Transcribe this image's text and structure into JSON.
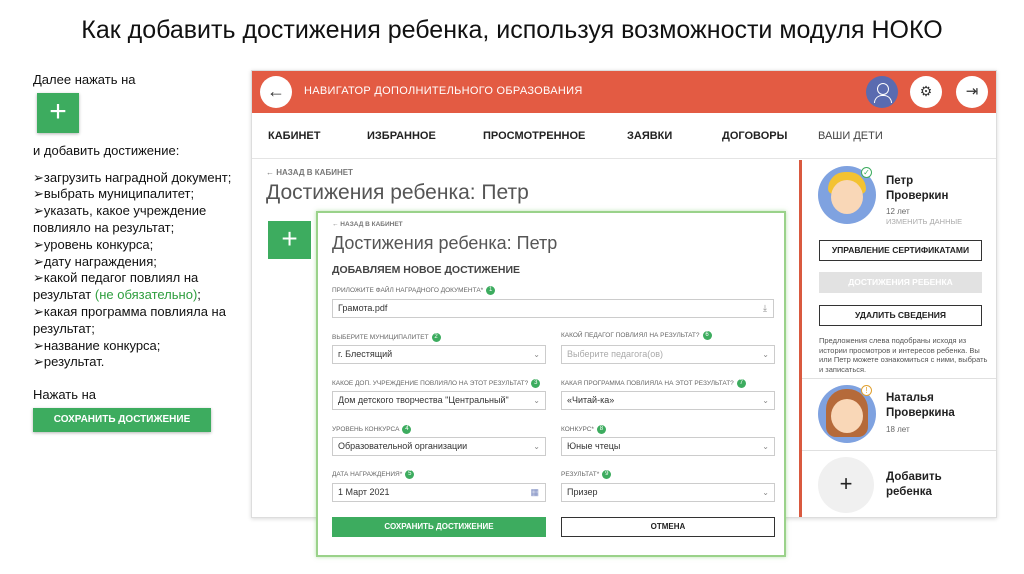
{
  "slide": {
    "title": "Как добавить достижения ребенка, используя возможности модуля НОКО"
  },
  "instructions": {
    "intro": "Далее нажать на",
    "plus_icon": "+",
    "add_text": "и добавить достижение:",
    "steps": [
      "➢загрузить наградной документ;",
      "➢выбрать муниципалитет;",
      "➢указать, какое учреждение повлияло на результат;",
      "➢уровень конкурса;",
      "➢дату награждения;",
      "➢какой педагог повлиял на результат",
      "➢какая программа повлияла на результат;",
      "➢название конкурса;",
      "➢результат."
    ],
    "optional_note": "(не обязательно)",
    "optional_suffix": ";",
    "press": "Нажать на",
    "save_button": "СОХРАНИТЬ ДОСТИЖЕНИЕ"
  },
  "app": {
    "title": "НАВИГАТОР ДОПОЛНИТЕЛЬНОГО ОБРАЗОВАНИЯ",
    "back_icon": "←",
    "settings_icon": "⚙",
    "exit_icon": "⇥",
    "nav": [
      "КАБИНЕТ",
      "ИЗБРАННОЕ",
      "ПРОСМОТРЕННОЕ",
      "ЗАЯВКИ",
      "ДОГОВОРЫ",
      "ВАШИ ДЕТИ"
    ],
    "breadcrumb": "←  НАЗАД В КАБИНЕТ",
    "page_title": "Достижения ребенка: Петр",
    "plus_icon": "+"
  },
  "sidebar": {
    "child1": {
      "first_name": "Петр",
      "last_name": "Проверкин",
      "age": "12 лет",
      "edit": "ИЗМЕНИТЬ ДАННЫЕ",
      "check_icon": "✓"
    },
    "buttons": [
      "УПРАВЛЕНИЕ СЕРТИФИКАТАМИ",
      "ДОСТИЖЕНИЯ РЕБЕНКА",
      "УДАЛИТЬ СВЕДЕНИЯ"
    ],
    "note": "Предложения слева подобраны исходя из истории просмотров и интересов ребенка. Вы или Петр можете ознакомиться с ними, выбрать и записаться.",
    "child2": {
      "first_name": "Наталья",
      "last_name": "Проверкина",
      "age": "18 лет",
      "warn_icon": "!"
    },
    "add_child": {
      "icon": "+",
      "line1": "Добавить",
      "line2": "ребенка"
    }
  },
  "modal": {
    "breadcrumb": "←  НАЗАД В КАБИНЕТ",
    "title": "Достижения ребенка: Петр",
    "subtitle": "ДОБАВЛЯЕМ НОВОЕ ДОСТИЖЕНИЕ",
    "file": {
      "label": "ПРИЛОЖИТЕ ФАЙЛ НАГРАДНОГО ДОКУМЕНТА*",
      "num": "1",
      "value": "Грамота.pdf",
      "icon": "⤓"
    },
    "municipality": {
      "label": "ВЫБЕРИТЕ МУНИЦИПАЛИТЕТ",
      "num": "2",
      "value": "г. Блестящий"
    },
    "institution": {
      "label": "КАКОЕ ДОП. УЧРЕЖДЕНИЕ ПОВЛИЯЛО НА ЭТОТ РЕЗУЛЬТАТ?",
      "num": "3",
      "value": "Дом детского творчества \"Центральный\""
    },
    "level": {
      "label": "УРОВЕНЬ КОНКУРСА",
      "num": "4",
      "value": "Образовательной организации"
    },
    "date": {
      "label": "ДАТА НАГРАЖДЕНИЯ*",
      "num": "5",
      "value": "1 Март 2021",
      "icon": "▦"
    },
    "teacher": {
      "label": "КАКОЙ ПЕДАГОГ ПОВЛИЯЛ НА РЕЗУЛЬТАТ?",
      "num": "6",
      "value": "Выберите педагога(ов)"
    },
    "program": {
      "label": "КАКАЯ ПРОГРАММА ПОВЛИЯЛА НА ЭТОТ РЕЗУЛЬТАТ?",
      "num": "7",
      "value": "«Читай-ка»"
    },
    "contest": {
      "label": "КОНКУРС*",
      "num": "8",
      "value": "Юные чтецы"
    },
    "result": {
      "label": "РЕЗУЛЬТАТ*",
      "num": "9",
      "value": "Призер"
    },
    "chevron": "⌄",
    "save": "СОХРАНИТЬ ДОСТИЖЕНИЕ",
    "cancel": "ОТМЕНА"
  }
}
